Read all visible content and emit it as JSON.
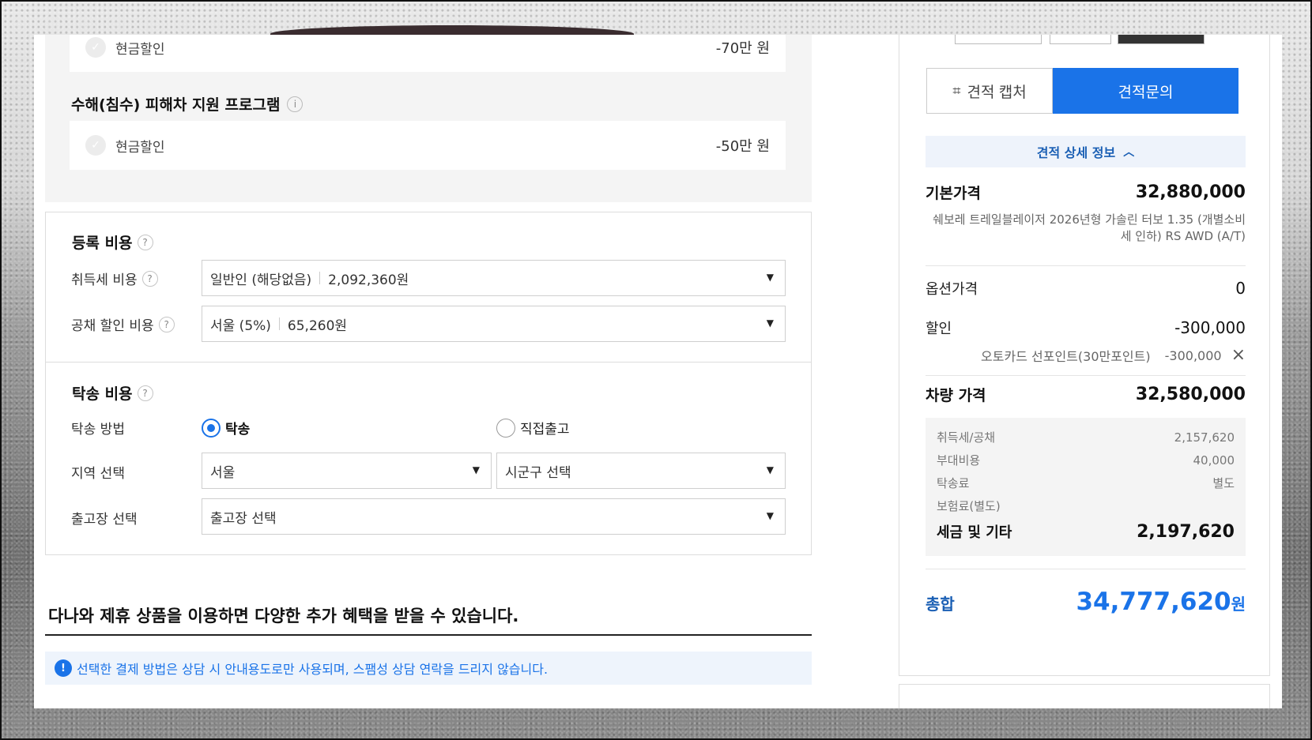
{
  "benefits": {
    "row1": {
      "label": "현금할인",
      "amount": "-70만 원"
    },
    "flood_title": "수해(침수) 피해차 지원 프로그램",
    "row2": {
      "label": "현금할인",
      "amount": "-50만 원"
    }
  },
  "registration": {
    "title": "등록 비용",
    "acquisition_label": "취득세 비용",
    "acquisition_type": "일반인 (해당없음)",
    "acquisition_value": "2,092,360원",
    "bond_label": "공채 할인 비용",
    "bond_region": "서울 (5%)",
    "bond_value": "65,260원"
  },
  "delivery": {
    "title": "탁송 비용",
    "method_label": "탁송 방법",
    "option_delivery": "탁송",
    "option_pickup": "직접출고",
    "selected": "탁송",
    "region_label": "지역 선택",
    "region_value": "서울",
    "district_value": "시군구 선택",
    "depot_label": "출고장 선택",
    "depot_value": "출고장 선택"
  },
  "partner": {
    "title": "다나와 제휴 상품을 이용하면 다양한 추가 혜택을 받을 수 있습니다.",
    "notice": "선택한 결제 방법은 상담 시 안내용도로만 사용되며, 스팸성 상담 연락을 드리지 않습니다."
  },
  "quote": {
    "capture_label": "견적 캡처",
    "inquiry_label": "견적문의",
    "detail_toggle": "견적 상세 정보",
    "base_label": "기본가격",
    "base_value": "32,880,000",
    "model_desc": "쉐보레 트레일블레이저 2026년형 가솔린 터보 1.35 (개별소비세 인하) RS AWD (A/T)",
    "option_label": "옵션가격",
    "option_value": "0",
    "discount_label": "할인",
    "discount_value": "-300,000",
    "discount_item_label": "오토카드 선포인트(30만포인트)",
    "discount_item_value": "-300,000",
    "car_price_label": "차량 가격",
    "car_price_value": "32,580,000",
    "tax_rows": [
      {
        "label": "취득세/공채",
        "value": "2,157,620"
      },
      {
        "label": "부대비용",
        "value": "40,000"
      },
      {
        "label": "탁송료",
        "value": "별도"
      },
      {
        "label": "보험료(별도)",
        "value": ""
      }
    ],
    "tax_total_label": "세금 및 기타",
    "tax_total_value": "2,197,620",
    "grand_label": "총합",
    "grand_value": "34,777,620",
    "grand_unit": "원"
  },
  "colors": {
    "accent": "#1a73e8",
    "accent_dark": "#1a5fb4"
  },
  "icons": [
    "check-icon",
    "info-icon",
    "question-icon",
    "dropdown-arrow-icon",
    "crop-icon",
    "chevron-up-icon",
    "close-icon",
    "notice-icon"
  ]
}
